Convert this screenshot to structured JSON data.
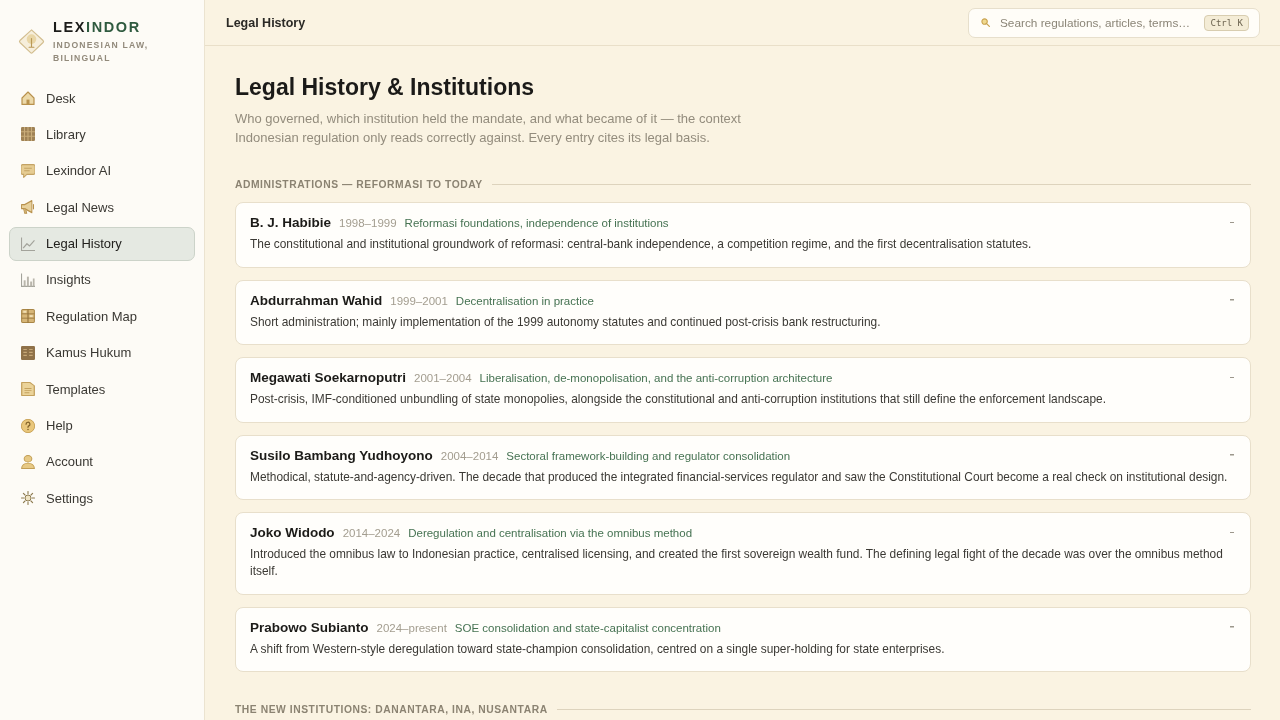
{
  "brand": {
    "name_lead": "LEX",
    "name_rest": "INDOR",
    "tagline": "INDONESIAN LAW, BILINGUAL"
  },
  "sidebar": {
    "items": [
      {
        "label": "Desk",
        "selected": false
      },
      {
        "label": "Library",
        "selected": false
      },
      {
        "label": "Lexindor AI",
        "selected": false
      },
      {
        "label": "Legal News",
        "selected": false
      },
      {
        "label": "Legal History",
        "selected": true
      },
      {
        "label": "Insights",
        "selected": false
      },
      {
        "label": "Regulation Map",
        "selected": false
      },
      {
        "label": "Kamus Hukum",
        "selected": false
      },
      {
        "label": "Templates",
        "selected": false
      },
      {
        "label": "Help",
        "selected": false
      },
      {
        "label": "Account",
        "selected": false
      },
      {
        "label": "Settings",
        "selected": false
      }
    ]
  },
  "topbar": {
    "title": "Legal History",
    "search": {
      "placeholder": "Search regulations, articles, terms…",
      "shortcut": "Ctrl K"
    }
  },
  "page": {
    "title": "Legal History & Institutions",
    "intro": "Who governed, which institution held the mandate, and what became of it — the context Indonesian regulation only reads correctly against. Every entry cites its legal basis."
  },
  "sections": [
    {
      "heading": "ADMINISTRATIONS — REFORMASI TO TODAY",
      "entries": [
        {
          "name": "B. J. Habibie",
          "years": "1998–1999",
          "theme": "Reformasi foundations, independence of institutions",
          "summary": "The constitutional and institutional groundwork of reformasi: central-bank independence, a competition regime, and the first decentralisation statutes."
        },
        {
          "name": "Abdurrahman Wahid",
          "years": "1999–2001",
          "theme": "Decentralisation in practice",
          "summary": "Short administration; mainly implementation of the 1999 autonomy statutes and continued post-crisis bank restructuring."
        },
        {
          "name": "Megawati Soekarnoputri",
          "years": "2001–2004",
          "theme": "Liberalisation, de-monopolisation, and the anti-corruption architecture",
          "summary": "Post-crisis, IMF-conditioned unbundling of state monopolies, alongside the constitutional and anti-corruption institutions that still define the enforcement landscape."
        },
        {
          "name": "Susilo Bambang Yudhoyono",
          "years": "2004–2014",
          "theme": "Sectoral framework-building and regulator consolidation",
          "summary": "Methodical, statute-and-agency-driven. The decade that produced the integrated financial-services regulator and saw the Constitutional Court become a real check on institutional design."
        },
        {
          "name": "Joko Widodo",
          "years": "2014–2024",
          "theme": "Deregulation and centralisation via the omnibus method",
          "summary": "Introduced the omnibus law to Indonesian practice, centralised licensing, and created the first sovereign wealth fund. The defining legal fight of the decade was over the omnibus method itself."
        },
        {
          "name": "Prabowo Subianto",
          "years": "2024–present",
          "theme": "SOE consolidation and state-capitalist concentration",
          "summary": "A shift from Western-style deregulation toward state-champion consolidation, centred on a single super-holding for state enterprises."
        }
      ]
    },
    {
      "heading": "THE NEW INSTITUTIONS: DANANTARA, INA, NUSANTARA"
    }
  ]
}
